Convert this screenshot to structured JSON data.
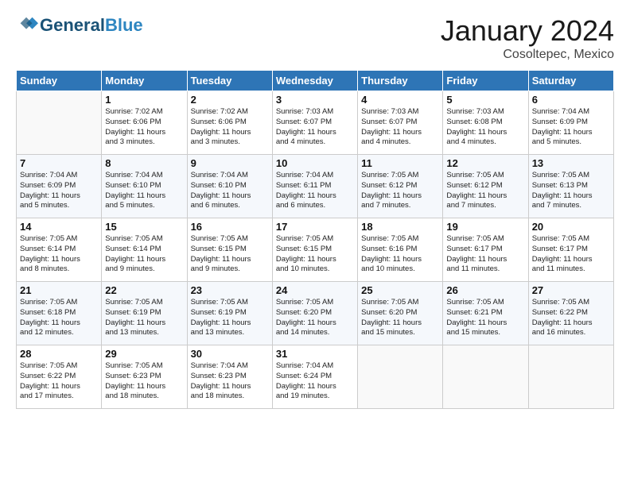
{
  "header": {
    "logo_line1": "General",
    "logo_line2": "Blue",
    "month": "January 2024",
    "location": "Cosoltepec, Mexico"
  },
  "days_of_week": [
    "Sunday",
    "Monday",
    "Tuesday",
    "Wednesday",
    "Thursday",
    "Friday",
    "Saturday"
  ],
  "weeks": [
    [
      {
        "day": "",
        "info": ""
      },
      {
        "day": "1",
        "info": "Sunrise: 7:02 AM\nSunset: 6:06 PM\nDaylight: 11 hours\nand 3 minutes."
      },
      {
        "day": "2",
        "info": "Sunrise: 7:02 AM\nSunset: 6:06 PM\nDaylight: 11 hours\nand 3 minutes."
      },
      {
        "day": "3",
        "info": "Sunrise: 7:03 AM\nSunset: 6:07 PM\nDaylight: 11 hours\nand 4 minutes."
      },
      {
        "day": "4",
        "info": "Sunrise: 7:03 AM\nSunset: 6:07 PM\nDaylight: 11 hours\nand 4 minutes."
      },
      {
        "day": "5",
        "info": "Sunrise: 7:03 AM\nSunset: 6:08 PM\nDaylight: 11 hours\nand 4 minutes."
      },
      {
        "day": "6",
        "info": "Sunrise: 7:04 AM\nSunset: 6:09 PM\nDaylight: 11 hours\nand 5 minutes."
      }
    ],
    [
      {
        "day": "7",
        "info": "Sunrise: 7:04 AM\nSunset: 6:09 PM\nDaylight: 11 hours\nand 5 minutes."
      },
      {
        "day": "8",
        "info": "Sunrise: 7:04 AM\nSunset: 6:10 PM\nDaylight: 11 hours\nand 5 minutes."
      },
      {
        "day": "9",
        "info": "Sunrise: 7:04 AM\nSunset: 6:10 PM\nDaylight: 11 hours\nand 6 minutes."
      },
      {
        "day": "10",
        "info": "Sunrise: 7:04 AM\nSunset: 6:11 PM\nDaylight: 11 hours\nand 6 minutes."
      },
      {
        "day": "11",
        "info": "Sunrise: 7:05 AM\nSunset: 6:12 PM\nDaylight: 11 hours\nand 7 minutes."
      },
      {
        "day": "12",
        "info": "Sunrise: 7:05 AM\nSunset: 6:12 PM\nDaylight: 11 hours\nand 7 minutes."
      },
      {
        "day": "13",
        "info": "Sunrise: 7:05 AM\nSunset: 6:13 PM\nDaylight: 11 hours\nand 7 minutes."
      }
    ],
    [
      {
        "day": "14",
        "info": "Sunrise: 7:05 AM\nSunset: 6:14 PM\nDaylight: 11 hours\nand 8 minutes."
      },
      {
        "day": "15",
        "info": "Sunrise: 7:05 AM\nSunset: 6:14 PM\nDaylight: 11 hours\nand 9 minutes."
      },
      {
        "day": "16",
        "info": "Sunrise: 7:05 AM\nSunset: 6:15 PM\nDaylight: 11 hours\nand 9 minutes."
      },
      {
        "day": "17",
        "info": "Sunrise: 7:05 AM\nSunset: 6:15 PM\nDaylight: 11 hours\nand 10 minutes."
      },
      {
        "day": "18",
        "info": "Sunrise: 7:05 AM\nSunset: 6:16 PM\nDaylight: 11 hours\nand 10 minutes."
      },
      {
        "day": "19",
        "info": "Sunrise: 7:05 AM\nSunset: 6:17 PM\nDaylight: 11 hours\nand 11 minutes."
      },
      {
        "day": "20",
        "info": "Sunrise: 7:05 AM\nSunset: 6:17 PM\nDaylight: 11 hours\nand 11 minutes."
      }
    ],
    [
      {
        "day": "21",
        "info": "Sunrise: 7:05 AM\nSunset: 6:18 PM\nDaylight: 11 hours\nand 12 minutes."
      },
      {
        "day": "22",
        "info": "Sunrise: 7:05 AM\nSunset: 6:19 PM\nDaylight: 11 hours\nand 13 minutes."
      },
      {
        "day": "23",
        "info": "Sunrise: 7:05 AM\nSunset: 6:19 PM\nDaylight: 11 hours\nand 13 minutes."
      },
      {
        "day": "24",
        "info": "Sunrise: 7:05 AM\nSunset: 6:20 PM\nDaylight: 11 hours\nand 14 minutes."
      },
      {
        "day": "25",
        "info": "Sunrise: 7:05 AM\nSunset: 6:20 PM\nDaylight: 11 hours\nand 15 minutes."
      },
      {
        "day": "26",
        "info": "Sunrise: 7:05 AM\nSunset: 6:21 PM\nDaylight: 11 hours\nand 15 minutes."
      },
      {
        "day": "27",
        "info": "Sunrise: 7:05 AM\nSunset: 6:22 PM\nDaylight: 11 hours\nand 16 minutes."
      }
    ],
    [
      {
        "day": "28",
        "info": "Sunrise: 7:05 AM\nSunset: 6:22 PM\nDaylight: 11 hours\nand 17 minutes."
      },
      {
        "day": "29",
        "info": "Sunrise: 7:05 AM\nSunset: 6:23 PM\nDaylight: 11 hours\nand 18 minutes."
      },
      {
        "day": "30",
        "info": "Sunrise: 7:04 AM\nSunset: 6:23 PM\nDaylight: 11 hours\nand 18 minutes."
      },
      {
        "day": "31",
        "info": "Sunrise: 7:04 AM\nSunset: 6:24 PM\nDaylight: 11 hours\nand 19 minutes."
      },
      {
        "day": "",
        "info": ""
      },
      {
        "day": "",
        "info": ""
      },
      {
        "day": "",
        "info": ""
      }
    ]
  ]
}
